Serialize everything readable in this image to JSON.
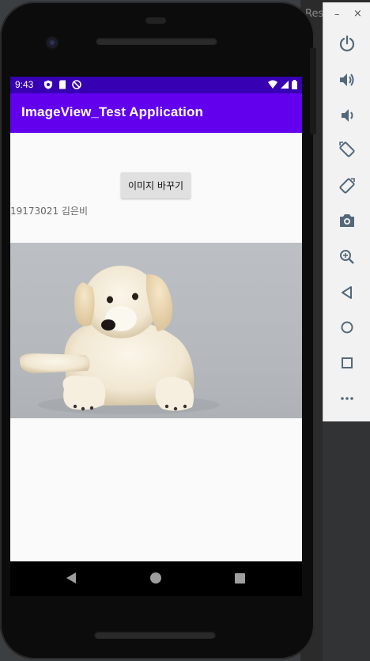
{
  "ide": {
    "tab_text": "Res"
  },
  "status_bar": {
    "time": "9:43"
  },
  "app_bar": {
    "title": "ImageView_Test Application"
  },
  "main": {
    "change_button_label": "이미지 바꾸기",
    "student_label": "19173021 김은비"
  },
  "photo": {
    "subject": "puppy-photo"
  },
  "emulator_toolbar": {
    "minimize": "–",
    "close": "×",
    "buttons": [
      "power-icon",
      "volume-up-icon",
      "volume-down-icon",
      "rotate-left-icon",
      "rotate-right-icon",
      "camera-icon",
      "zoom-icon",
      "back-icon",
      "home-icon",
      "overview-icon",
      "more-icon"
    ]
  },
  "colors": {
    "status_bar": "#3700b3",
    "app_bar": "#6200ee",
    "screen_bg": "#fafafa",
    "button_bg": "#e0e0e0",
    "toolbar_icon": "#54687a"
  }
}
